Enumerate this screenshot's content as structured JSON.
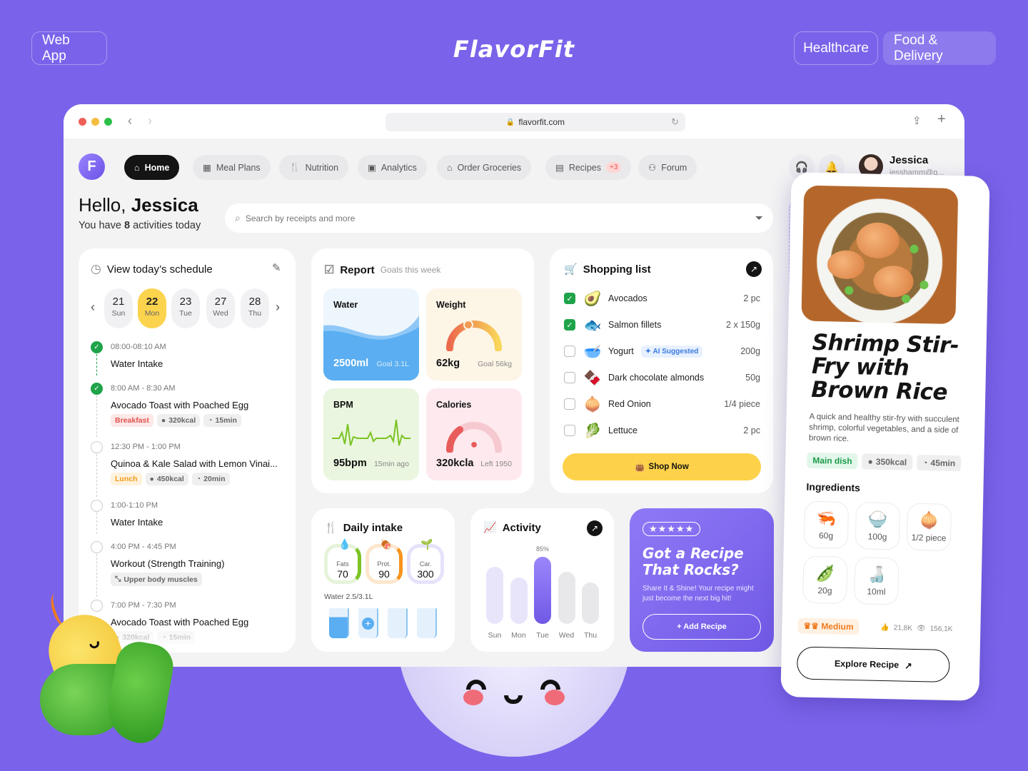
{
  "page": {
    "left_pill": "Web App",
    "brand": "FlavorFit",
    "right_pills": [
      "Healthcare",
      "Food & Delivery"
    ]
  },
  "browser": {
    "url": "flavorfit.com"
  },
  "nav": {
    "logo_letter": "F",
    "items": [
      {
        "label": "Home",
        "icon": "home-icon",
        "active": true
      },
      {
        "label": "Meal Plans",
        "icon": "calendar-icon"
      },
      {
        "label": "Nutrition",
        "icon": "fork-knife-icon"
      },
      {
        "label": "Analytics",
        "icon": "presentation-chart-icon"
      },
      {
        "label": "Order Groceries",
        "icon": "store-icon"
      },
      {
        "label": "Recipes",
        "icon": "book-icon",
        "badge": "+3"
      },
      {
        "label": "Forum",
        "icon": "users-icon"
      }
    ],
    "user": {
      "name": "Jessica",
      "email": "jesshamm@g..."
    }
  },
  "greeting": {
    "hello": "Hello,",
    "name": "Jessica",
    "sub_prefix": "You have",
    "count": "8",
    "sub_suffix": "activities today"
  },
  "search": {
    "placeholder": "Search by receipts and more"
  },
  "schedule": {
    "title": "View today’s schedule",
    "days": [
      {
        "num": "21",
        "day": "Sun"
      },
      {
        "num": "22",
        "day": "Mon",
        "selected": true
      },
      {
        "num": "23",
        "day": "Tue"
      },
      {
        "num": "27",
        "day": "Wed"
      },
      {
        "num": "28",
        "day": "Thu"
      }
    ],
    "items": [
      {
        "time": "08:00-08:10 AM",
        "title": "Water Intake",
        "done": true,
        "tags": []
      },
      {
        "time": "8:00 AM - 8:30 AM",
        "title": "Avocado Toast with Poached Egg",
        "done": true,
        "tags": [
          "Breakfast",
          "320kcal",
          "15min"
        ]
      },
      {
        "time": "12:30 PM - 1:00 PM",
        "title": "Quinoa & Kale Salad with Lemon Vinai...",
        "done": false,
        "tags": [
          "Lunch",
          "450kcal",
          "20min"
        ]
      },
      {
        "time": "1:00-1:10 PM",
        "title": "Water Intake",
        "done": false,
        "tags": []
      },
      {
        "time": "4:00 PM - 4:45 PM",
        "title": "Workout (Strength Training)",
        "done": false,
        "tags": [
          "Upper body muscles"
        ]
      },
      {
        "time": "7:00 PM - 7:30 PM",
        "title": "Avocado Toast with Poached Egg",
        "done": false,
        "tags": [
          "320kcal",
          "15min"
        ]
      }
    ]
  },
  "report": {
    "title": "Report",
    "subtitle": "Goals this week",
    "water": {
      "label": "Water",
      "value": "2500ml",
      "goal": "Goal 3.1L"
    },
    "weight": {
      "label": "Weight",
      "value": "62kg",
      "goal": "Goal 56kg"
    },
    "bpm": {
      "label": "BPM",
      "value": "95bpm",
      "when": "15min ago"
    },
    "calories": {
      "label": "Calories",
      "value": "320kcla",
      "left": "Left 1950"
    }
  },
  "shopping": {
    "title": "Shopping list",
    "items": [
      {
        "name": "Avocados",
        "qty": "2 pc",
        "checked": true,
        "emoji": "🥑"
      },
      {
        "name": "Salmon fillets",
        "qty": "2 x 150g",
        "checked": true,
        "emoji": "🐟"
      },
      {
        "name": "Yogurt",
        "qty": "200g",
        "checked": false,
        "emoji": "🥣",
        "ai": "AI Suggested"
      },
      {
        "name": "Dark chocolate almonds",
        "qty": "50g",
        "checked": false,
        "emoji": "🍫"
      },
      {
        "name": "Red Onion",
        "qty": "1/4 piece",
        "checked": false,
        "emoji": "🧅"
      },
      {
        "name": "Lettuce",
        "qty": "2 pc",
        "checked": false,
        "emoji": "🥬"
      }
    ],
    "button": "Shop Now"
  },
  "intake": {
    "title": "Daily intake",
    "macros": [
      {
        "label": "Fats",
        "value": "70"
      },
      {
        "label": "Prot.",
        "value": "90"
      },
      {
        "label": "Car.",
        "value": "300"
      }
    ],
    "water_label": "Water 2.5/3.1L"
  },
  "activity": {
    "title": "Activity",
    "highlight_label": "85%",
    "days": [
      "Sun",
      "Mon",
      "Tue",
      "Wed",
      "Thu"
    ],
    "values": [
      0.73,
      0.59,
      0.85,
      0.66,
      0.53
    ]
  },
  "promo": {
    "rating": "★★★★★",
    "title": "Got a Recipe That Rocks?",
    "text": "Share It & Shine! Your recipe might just become the next big hit!",
    "button": "+ Add Recipe"
  },
  "recipe": {
    "title": "Shrimp Stir-Fry with Brown Rice",
    "description": "A quick and healthy stir-fry with succulent shrimp, colorful vegetables, and a side of brown rice.",
    "category": "Main dish",
    "kcal": "350kcal",
    "time": "45min",
    "ingredients_title": "Ingredients",
    "ingredients": [
      {
        "emoji": "🦐",
        "qty": "60g"
      },
      {
        "emoji": "🍚",
        "qty": "100g"
      },
      {
        "emoji": "🧅",
        "qty": "1/2 piece"
      },
      {
        "emoji": "🫛",
        "qty": "20g"
      },
      {
        "emoji": "🍶",
        "qty": "10ml"
      }
    ],
    "difficulty": "Medium",
    "likes": "21,8K",
    "views": "156,1K",
    "button": "Explore Recipe"
  }
}
